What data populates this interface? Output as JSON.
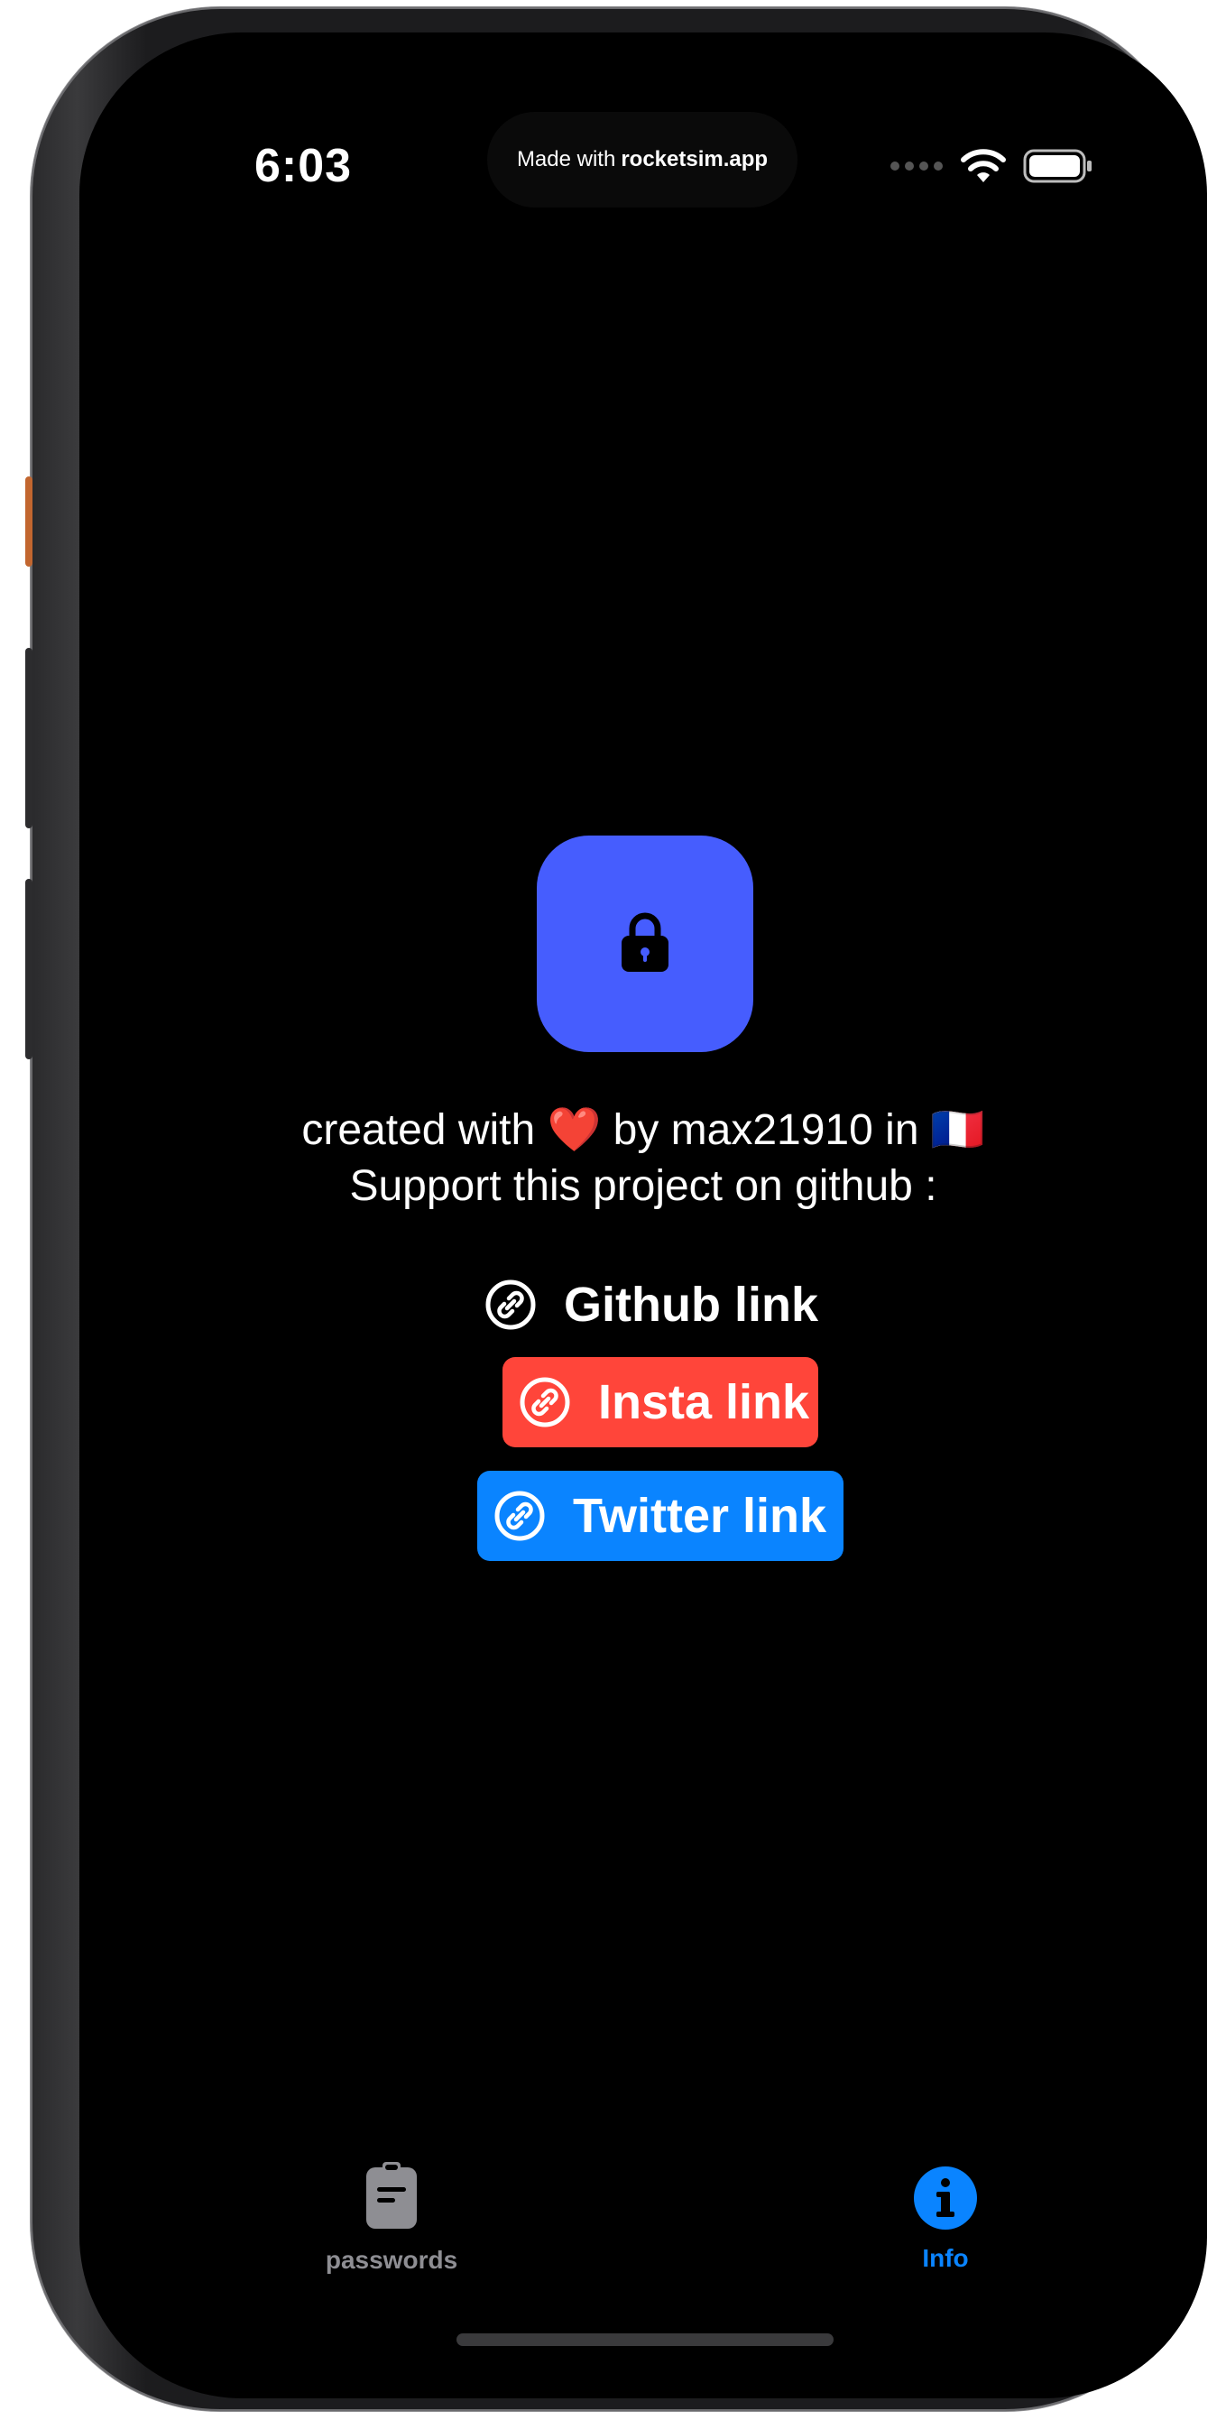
{
  "status_bar": {
    "time": "6:03",
    "island_prefix": "Made with",
    "island_brand": "rocketsim.app",
    "icons": [
      "signal-icon",
      "wifi-icon",
      "battery-icon"
    ]
  },
  "app_icon": {
    "icon": "lock-icon",
    "color": "#465dfe"
  },
  "credit": {
    "line1_a": "created with",
    "heart": "❤️",
    "line1_b": "by max21910 in",
    "flag": "🇫🇷",
    "line2": "Support this project on github :"
  },
  "links": {
    "github": {
      "label": "Github link",
      "icon": "link-icon"
    },
    "insta": {
      "label": "Insta link",
      "icon": "link-icon",
      "color": "#ff453a"
    },
    "twitter": {
      "label": "Twitter link",
      "icon": "link-icon",
      "color": "#0a84ff"
    }
  },
  "tab_bar": {
    "tabs": [
      {
        "label": "passwords",
        "icon": "clipboard-icon",
        "color": "#8e8e93",
        "selected": false
      },
      {
        "label": "Info",
        "icon": "info-icon",
        "color": "#0a84ff",
        "selected": true
      }
    ]
  }
}
